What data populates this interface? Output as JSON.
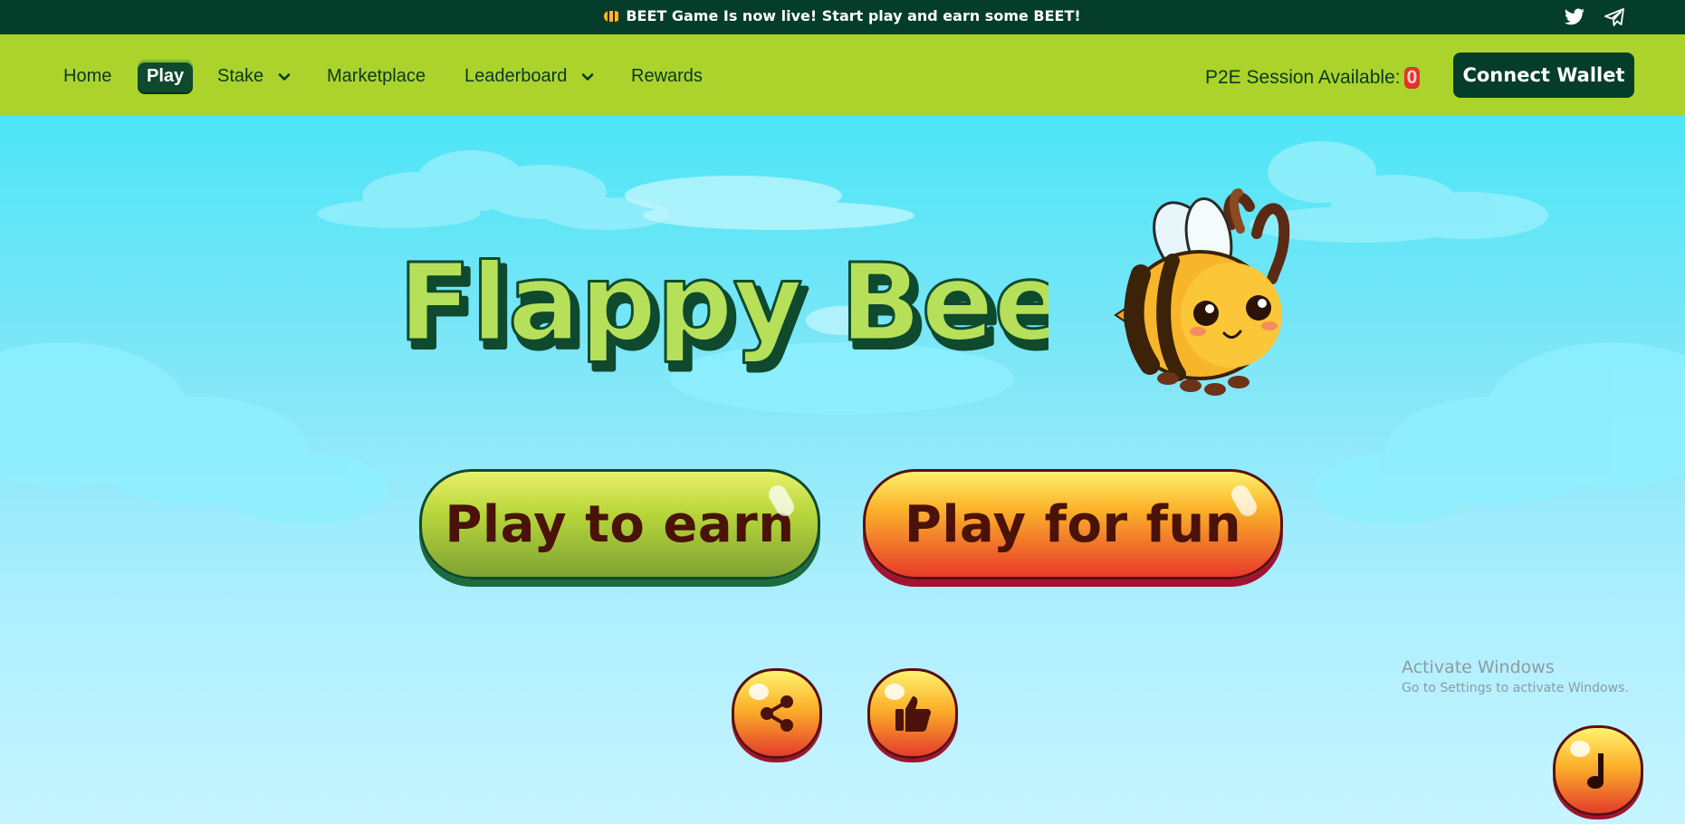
{
  "announcement": {
    "text": "BEET Game Is now live! Start play and earn some BEET!",
    "icon": "bee-icon"
  },
  "social": {
    "twitter_icon": "twitter-icon",
    "telegram_icon": "telegram-icon"
  },
  "nav": {
    "items": [
      {
        "label": "Home",
        "active": false
      },
      {
        "label": "Play",
        "active": true
      },
      {
        "label": "Stake",
        "active": false,
        "dropdown": true
      },
      {
        "label": "Marketplace",
        "active": false
      },
      {
        "label": "Leaderboard",
        "active": false,
        "dropdown": true
      },
      {
        "label": "Rewards",
        "active": false
      }
    ],
    "p2e_label": "P2E Session Available:",
    "p2e_count": "0",
    "connect_label": "Connect Wallet"
  },
  "game": {
    "title": "Flappy Bee",
    "play_to_earn_label": "Play to earn",
    "play_for_fun_label": "Play for fun",
    "share_icon": "share-icon",
    "like_icon": "thumbs-up-icon",
    "music_icon": "music-note-icon"
  },
  "system": {
    "activate_title": "Activate Windows",
    "activate_sub": "Go to Settings to activate Windows."
  },
  "colors": {
    "topbar": "#043d2a",
    "navbar": "#abd32b",
    "sky": "#4de5f7",
    "accent_dark": "#043d2a",
    "badge": "#e0342d"
  }
}
